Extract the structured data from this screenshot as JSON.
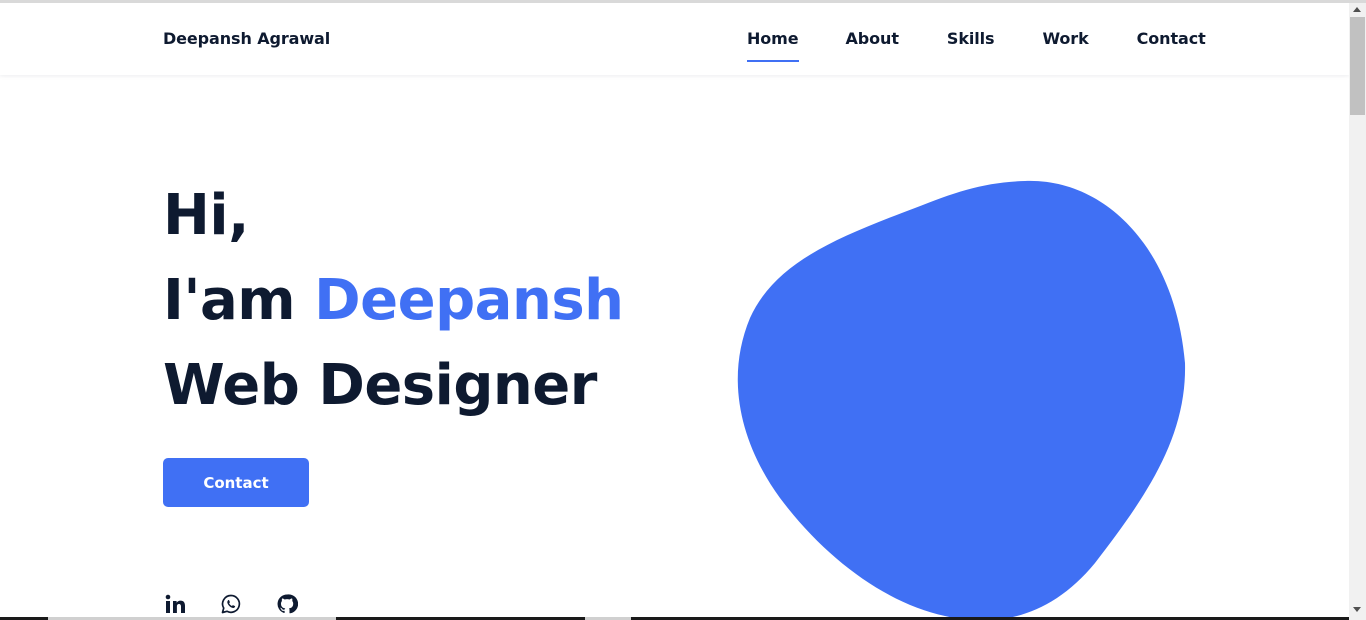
{
  "header": {
    "logo": "Deepansh Agrawal",
    "nav": [
      {
        "label": "Home",
        "active": true
      },
      {
        "label": "About",
        "active": false
      },
      {
        "label": "Skills",
        "active": false
      },
      {
        "label": "Work",
        "active": false
      },
      {
        "label": "Contact",
        "active": false
      }
    ]
  },
  "hero": {
    "line1": "Hi,",
    "line2_prefix": "I'am ",
    "line2_name": "Deepansh",
    "line3": "Web Designer",
    "contact_button": "Contact"
  },
  "socials": {
    "icons": [
      "linkedin-icon",
      "whatsapp-icon",
      "github-icon"
    ]
  },
  "colors": {
    "accent": "#4070f4",
    "text": "#0e1a30"
  }
}
